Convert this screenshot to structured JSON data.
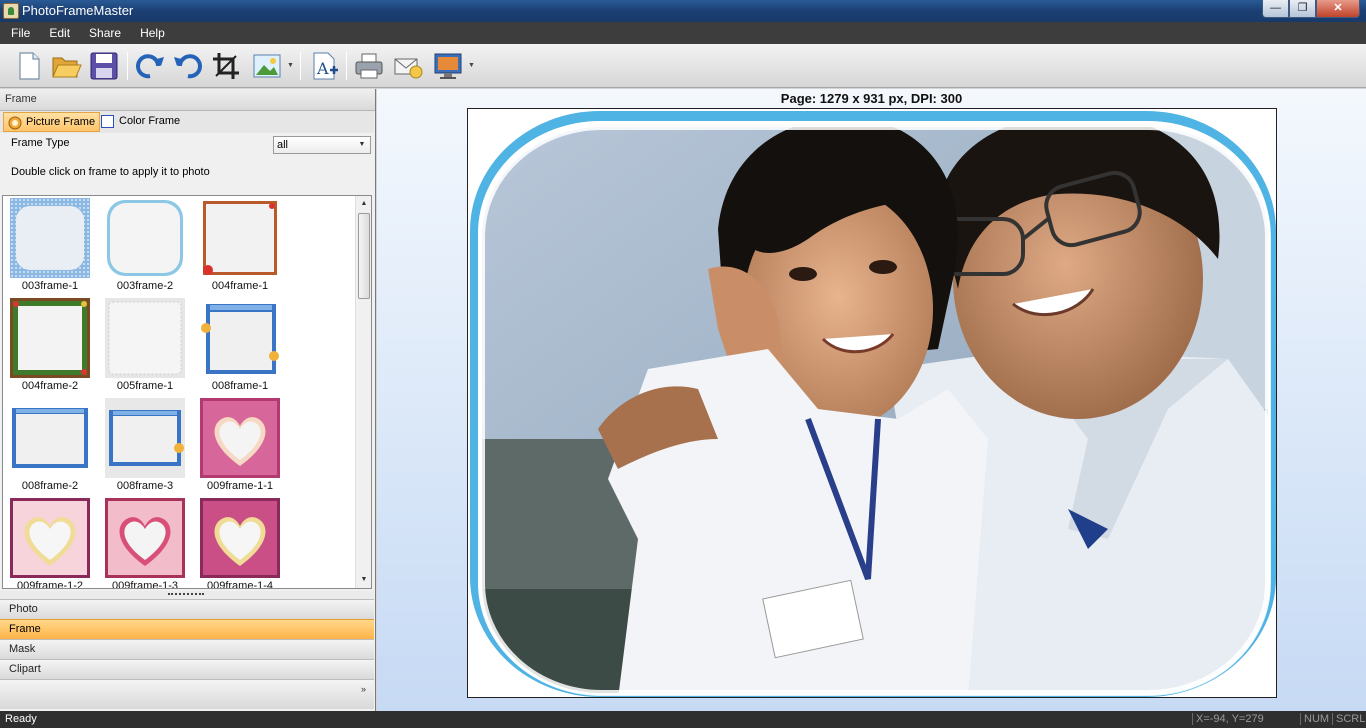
{
  "window": {
    "title": "PhotoFrameMaster",
    "buttons": {
      "minimize": "—",
      "maximize": "❐",
      "close": "✕"
    }
  },
  "menu": [
    "File",
    "Edit",
    "Share",
    "Help"
  ],
  "toolbar": {
    "icons": [
      "new-document-icon",
      "open-folder-icon",
      "save-icon",
      "redo-icon",
      "undo-icon",
      "crop-icon",
      "insert-image-icon",
      "add-text-icon",
      "print-icon",
      "email-icon",
      "set-wallpaper-icon"
    ]
  },
  "left_panel": {
    "header": "Frame",
    "tabs": [
      {
        "label": "Picture Frame",
        "active": true
      },
      {
        "label": "Color Frame",
        "active": false
      }
    ],
    "frame_type_label": "Frame Type",
    "frame_type_value": "all",
    "hint": "Double click on frame to apply it to photo",
    "frames": [
      "003frame-1",
      "003frame-2",
      "004frame-1",
      "004frame-2",
      "005frame-1",
      "008frame-1",
      "008frame-2",
      "008frame-3",
      "009frame-1-1",
      "009frame-1-2",
      "009frame-1-3",
      "009frame-1-4"
    ],
    "nav_items": [
      {
        "label": "Photo",
        "active": false
      },
      {
        "label": "Frame",
        "active": true
      },
      {
        "label": "Mask",
        "active": false
      },
      {
        "label": "Clipart",
        "active": false
      }
    ],
    "footer_chevron": "»"
  },
  "canvas": {
    "page_info": "Page: 1279 x 931 px, DPI: 300"
  },
  "status": {
    "text": "Ready",
    "coords": "X=-94, Y=279",
    "num": "NUM",
    "scrl": "SCRL"
  },
  "colors": {
    "active_tab": "#ffc46a",
    "frame_border": "#4fb3e3",
    "titlebar": "#1b3f73"
  }
}
